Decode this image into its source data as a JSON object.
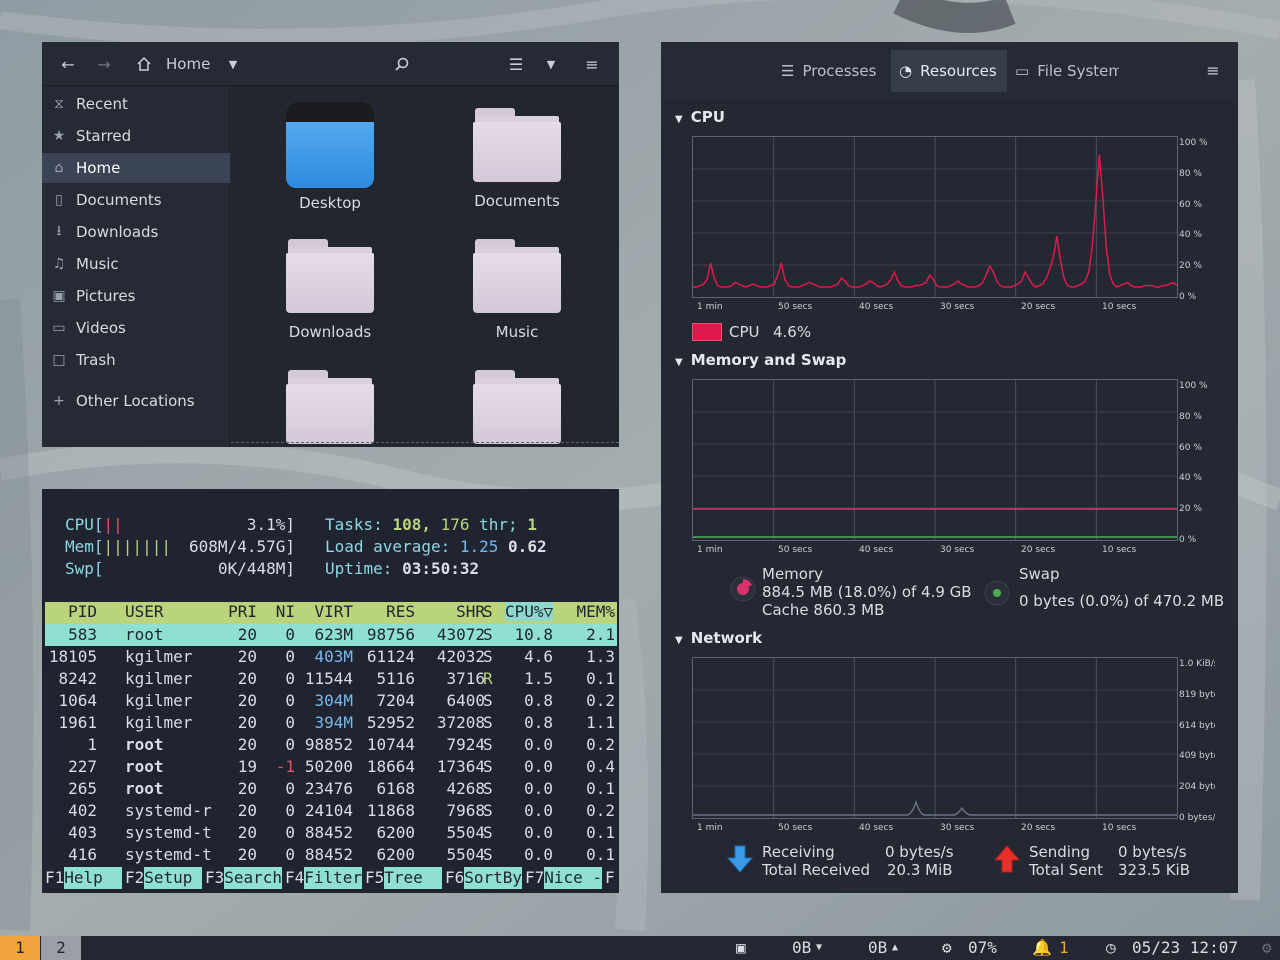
{
  "file_manager": {
    "location": "Home",
    "sidebar": [
      {
        "label": "Recent",
        "icon": "clock-icon"
      },
      {
        "label": "Starred",
        "icon": "star-icon"
      },
      {
        "label": "Home",
        "icon": "home-icon",
        "active": true
      },
      {
        "label": "Documents",
        "icon": "document-icon"
      },
      {
        "label": "Downloads",
        "icon": "download-icon"
      },
      {
        "label": "Music",
        "icon": "music-icon"
      },
      {
        "label": "Pictures",
        "icon": "picture-icon"
      },
      {
        "label": "Videos",
        "icon": "video-icon"
      },
      {
        "label": "Trash",
        "icon": "trash-icon"
      },
      {
        "label": "Other Locations",
        "icon": "plus-icon"
      }
    ],
    "files": [
      {
        "name": "Desktop"
      },
      {
        "name": "Documents"
      },
      {
        "name": "Downloads"
      },
      {
        "name": "Music"
      },
      {
        "name": ""
      },
      {
        "name": ""
      }
    ]
  },
  "htop": {
    "cpu_label": "CPU[",
    "cpu_bar": "||",
    "cpu_value": "3.1%]",
    "mem_label": "Mem[",
    "mem_bar": "|||||||",
    "mem_value": "608M/4.57G]",
    "swp_label": "Swp[",
    "swp_value": "0K/448M]",
    "tasks_label": "Tasks:",
    "tasks": "108,",
    "threads": "176",
    "threads_label": "thr;",
    "running": "1",
    "load_label": "Load average:",
    "load1": "1.25",
    "load5": "0.62",
    "uptime_label": "Uptime:",
    "uptime": "03:50:32",
    "columns": [
      "PID",
      "USER",
      "PRI",
      "NI",
      "VIRT",
      "RES",
      "SHR",
      "S",
      "CPU%▽",
      "MEM%"
    ],
    "rows": [
      [
        "583",
        "root",
        "20",
        "0",
        "623M",
        "98756",
        "43072",
        "S",
        "10.8",
        "2.1"
      ],
      [
        "18105",
        "kgilmer",
        "20",
        "0",
        "403M",
        "61124",
        "42032",
        "S",
        "4.6",
        "1.3"
      ],
      [
        "8242",
        "kgilmer",
        "20",
        "0",
        "11544",
        "5116",
        "3716",
        "R",
        "1.5",
        "0.1"
      ],
      [
        "1064",
        "kgilmer",
        "20",
        "0",
        "304M",
        "7204",
        "6400",
        "S",
        "0.8",
        "0.2"
      ],
      [
        "1961",
        "kgilmer",
        "20",
        "0",
        "394M",
        "52952",
        "37208",
        "S",
        "0.8",
        "1.1"
      ],
      [
        "1",
        "root",
        "20",
        "0",
        "98852",
        "10744",
        "7924",
        "S",
        "0.0",
        "0.2"
      ],
      [
        "227",
        "root",
        "19",
        "-1",
        "50200",
        "18664",
        "17364",
        "S",
        "0.0",
        "0.4"
      ],
      [
        "265",
        "root",
        "20",
        "0",
        "23476",
        "6168",
        "4268",
        "S",
        "0.0",
        "0.1"
      ],
      [
        "402",
        "systemd-r",
        "20",
        "0",
        "24104",
        "11868",
        "7968",
        "S",
        "0.0",
        "0.2"
      ],
      [
        "403",
        "systemd-t",
        "20",
        "0",
        "88452",
        "6200",
        "5504",
        "S",
        "0.0",
        "0.1"
      ],
      [
        "416",
        "systemd-t",
        "20",
        "0",
        "88452",
        "6200",
        "5504",
        "S",
        "0.0",
        "0.1"
      ]
    ],
    "fkeys": [
      {
        "key": "F1",
        "label": "Help  "
      },
      {
        "key": "F2",
        "label": "Setup "
      },
      {
        "key": "F3",
        "label": "Search"
      },
      {
        "key": "F4",
        "label": "Filter"
      },
      {
        "key": "F5",
        "label": "Tree  "
      },
      {
        "key": "F6",
        "label": "SortBy"
      },
      {
        "key": "F7",
        "label": "Nice -"
      },
      {
        "key": "F",
        "label": ""
      }
    ]
  },
  "system_monitor": {
    "tabs": [
      {
        "label": "Processes",
        "icon": "list-icon"
      },
      {
        "label": "Resources",
        "icon": "gauge-icon",
        "active": true
      },
      {
        "label": "File System",
        "icon": "drive-icon"
      }
    ],
    "cpu": {
      "section_title": "CPU",
      "legend_label": "CPU",
      "legend_value": "4.6%",
      "color": "#e0194d",
      "y_ticks": [
        "100 %",
        "80 %",
        "60 %",
        "40 %",
        "20 %",
        "0 %"
      ],
      "x_ticks": [
        "1 min",
        "50 secs",
        "40 secs",
        "30 secs",
        "20 secs",
        "10 secs"
      ],
      "samples": [
        4,
        4,
        5,
        6,
        9,
        20,
        10,
        5,
        4,
        4,
        4,
        5,
        7,
        6,
        5,
        4,
        5,
        6,
        5,
        4,
        4,
        4,
        5,
        6,
        12,
        20,
        9,
        5,
        4,
        4,
        4,
        5,
        6,
        7,
        6,
        5,
        4,
        4,
        4,
        4,
        5,
        6,
        10,
        8,
        5,
        4,
        4,
        4,
        5,
        6,
        8,
        7,
        5,
        4,
        5,
        6,
        9,
        14,
        8,
        5,
        4,
        4,
        4,
        5,
        5,
        6,
        7,
        12,
        9,
        5,
        4,
        4,
        4,
        5,
        6,
        8,
        6,
        5,
        4,
        4,
        4,
        5,
        7,
        12,
        18,
        14,
        8,
        5,
        4,
        4,
        4,
        5,
        6,
        8,
        14,
        10,
        6,
        4,
        5,
        6,
        10,
        16,
        24,
        38,
        22,
        10,
        5,
        4,
        4,
        5,
        6,
        8,
        14,
        30,
        60,
        92,
        64,
        30,
        12,
        6,
        4,
        5,
        6,
        7,
        5,
        4,
        4,
        4,
        5,
        5,
        5,
        4,
        4,
        5,
        5,
        6,
        7,
        5
      ]
    },
    "memory": {
      "section_title": "Memory and Swap",
      "y_ticks": [
        "100 %",
        "80 %",
        "60 %",
        "40 %",
        "20 %",
        "0 %"
      ],
      "x_ticks": [
        "1 min",
        "50 secs",
        "40 secs",
        "30 secs",
        "20 secs",
        "10 secs"
      ],
      "memory_percent": 18.0,
      "swap_percent": 0.0,
      "memory_color": "#d6336c",
      "swap_color": "#4caf50",
      "memory_label": "Memory",
      "memory_value": "884.5 MB (18.0%) of 4.9 GB",
      "cache_value": "Cache 860.3 MB",
      "swap_label": "Swap",
      "swap_value": "0 bytes (0.0%) of 470.2 MB"
    },
    "network": {
      "section_title": "Network",
      "y_ticks": [
        "1.0 KiB/s",
        "819 bytes/s",
        "614 bytes/s",
        "409 bytes/s",
        "204 bytes/s",
        "0 bytes/s"
      ],
      "x_ticks": [
        "1 min",
        "50 secs",
        "40 secs",
        "30 secs",
        "20 secs",
        "10 secs"
      ],
      "receiving_label": "Receiving",
      "receiving_value": "0 bytes/s",
      "total_received_label": "Total Received",
      "total_received_value": "20.3 MiB",
      "sending_label": "Sending",
      "sending_value": "0 bytes/s",
      "total_sent_label": "Total Sent",
      "total_sent_value": "323.5 KiB"
    }
  },
  "taskbar": {
    "workspaces": [
      "1",
      "2"
    ],
    "net_down": "0B",
    "net_up": "0B",
    "cpu": "07%",
    "notifications": "1",
    "datetime": "05/23 12:07"
  }
}
